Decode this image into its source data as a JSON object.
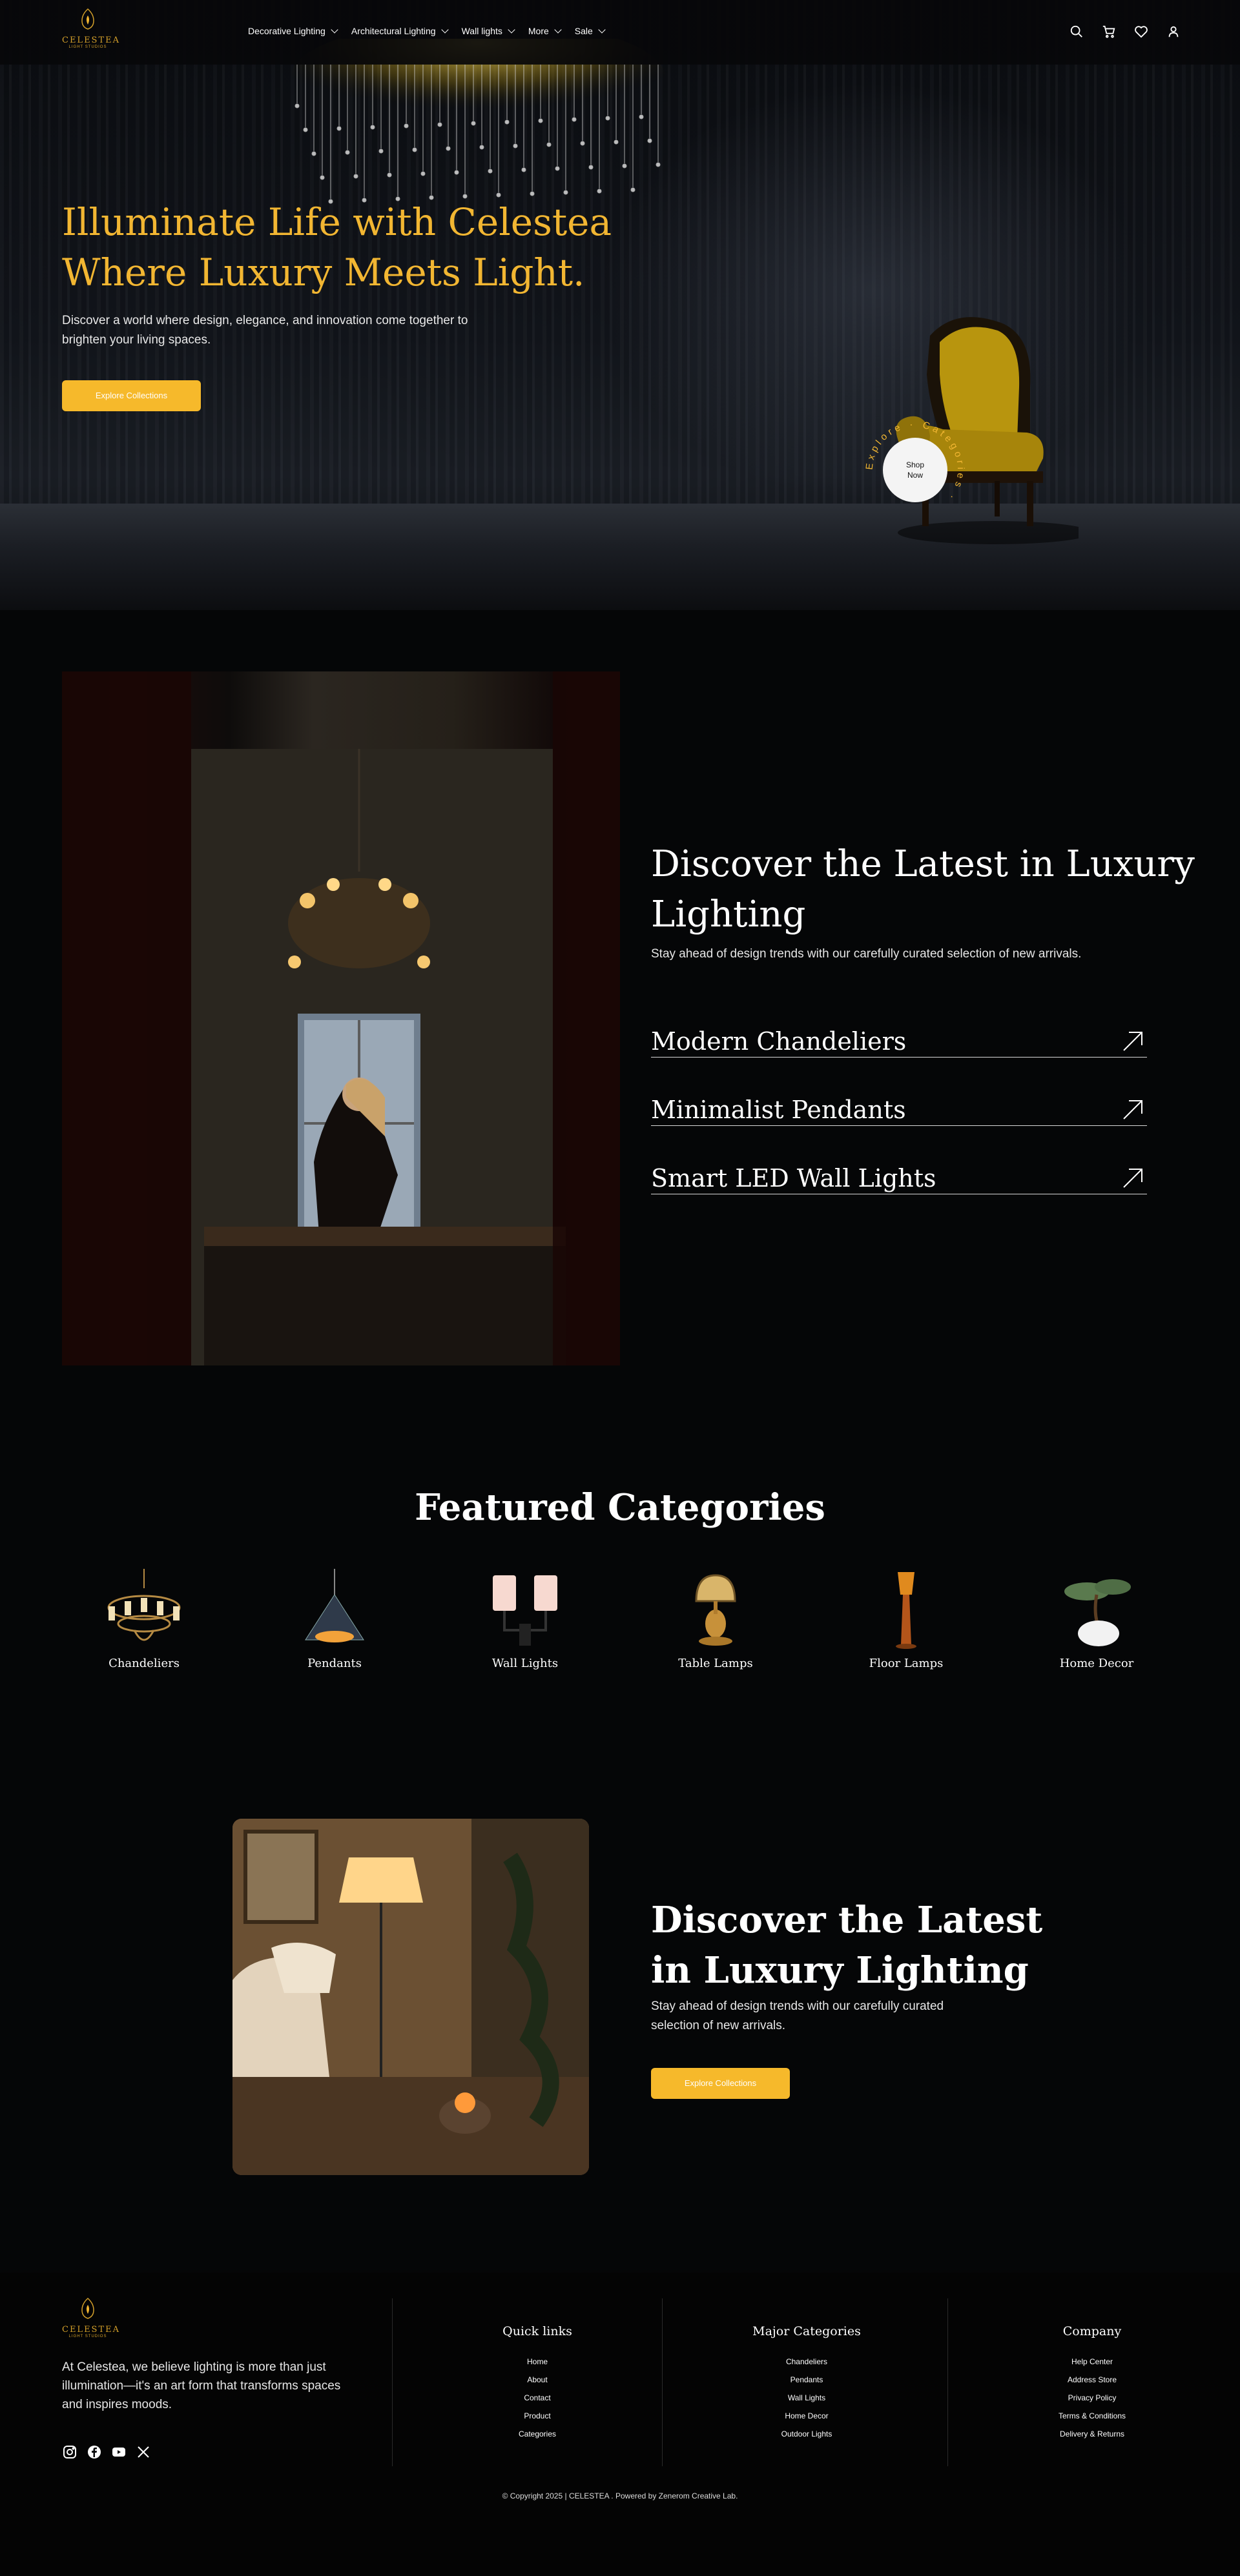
{
  "brand": {
    "name": "CELESTEA",
    "tagline": "LIGHT STUDIOS"
  },
  "nav": [
    {
      "label": "Decorative Lighting"
    },
    {
      "label": "Architectural Lighting"
    },
    {
      "label": "Wall lights"
    },
    {
      "label": "More"
    },
    {
      "label": "Sale"
    }
  ],
  "header_icons": [
    "search-icon",
    "cart-icon",
    "heart-icon",
    "user-icon"
  ],
  "hero": {
    "title_line1": "Illuminate Life with Celestea",
    "title_line2": "Where Luxury Meets Light.",
    "subtitle": "Discover a world where design, elegance, and innovation come together to brighten your living spaces.",
    "button": "Explore Collections",
    "circle_label_1": "Shop",
    "circle_label_2": "Now",
    "circle_ring_text": "Explore · Categories ·"
  },
  "discover": {
    "title_line1": "Discover the Latest in Luxury",
    "title_line2": "Lighting",
    "subtitle": "Stay ahead of design trends with our carefully curated selection of new arrivals.",
    "links": [
      {
        "label": "Modern Chandeliers"
      },
      {
        "label": "Minimalist Pendants"
      },
      {
        "label": "Smart LED Wall Lights"
      }
    ]
  },
  "featured": {
    "title": "Featured Categories",
    "categories": [
      {
        "label": "Chandeliers"
      },
      {
        "label": "Pendants"
      },
      {
        "label": "Wall Lights"
      },
      {
        "label": "Table Lamps"
      },
      {
        "label": "Floor Lamps"
      },
      {
        "label": "Home Decor"
      }
    ]
  },
  "discover2": {
    "title_line1": "Discover the Latest",
    "title_line2": "in Luxury Lighting",
    "subtitle": "Stay ahead of design trends with our carefully curated selection of new arrivals.",
    "button": "Explore Collections"
  },
  "footer": {
    "about": "At Celestea, we believe lighting is more than just illumination—it's an art form that transforms spaces and inspires moods.",
    "socials": [
      "instagram-icon",
      "facebook-icon",
      "youtube-icon",
      "x-icon"
    ],
    "columns": [
      {
        "title": "Quick links",
        "links": [
          "Home",
          "About",
          "Contact",
          "Product",
          "Categories"
        ]
      },
      {
        "title": "Major Categories",
        "links": [
          "Chandeliers",
          "Pendants",
          "Wall Lights",
          "Home Decor",
          "Outdoor Lights"
        ]
      },
      {
        "title": "Company",
        "links": [
          "Help Center",
          "Address Store",
          "Privacy Policy",
          "Terms & Conditions",
          "Delivery & Returns"
        ]
      }
    ],
    "copyright": "© Copyright 2025 | CELESTEA . Powered by Zenerom Creative Lab."
  },
  "colors": {
    "accent": "#f6b92b",
    "title_gold": "#f2b632",
    "background": "#050607"
  }
}
